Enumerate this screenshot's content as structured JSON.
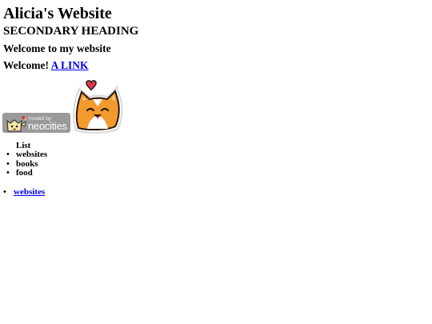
{
  "heading": "Alicia's Website",
  "subheading": "SECONDARY HEADING",
  "welcome_text": "Welcome to my website",
  "welcome_prefix": "Welcome!",
  "link_label": "A LINK",
  "badge": {
    "line1": "hosted by",
    "line2": "neocities"
  },
  "list": {
    "header": "List",
    "items": [
      "websites",
      "books",
      "food"
    ]
  },
  "nav": {
    "items": [
      "websites"
    ]
  },
  "colors": {
    "link": "#0000ee",
    "badge_bg": "#9a9a9a",
    "cat_orange": "#f39a2c",
    "heart": "#e8334a"
  },
  "icons": {
    "badge_logo": "neocities-cat-logo",
    "cat": "orange-cat-with-heart"
  }
}
